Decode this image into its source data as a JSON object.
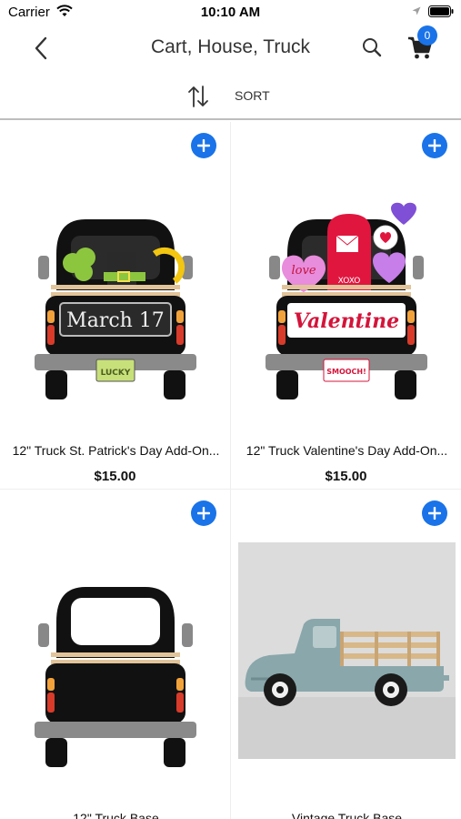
{
  "status_bar": {
    "carrier": "Carrier",
    "time": "10:10 AM"
  },
  "nav": {
    "title": "Cart, House, Truck",
    "cart_count": "0",
    "back_icon": "chevron-left-icon",
    "search_icon": "search-icon",
    "cart_icon": "cart-icon"
  },
  "sort": {
    "label": "SORT",
    "icon": "sort-arrows-icon"
  },
  "products": [
    {
      "name": "12\" Truck St. Patrick's Day Add-On...",
      "price": "$15.00",
      "image": {
        "kind": "truck",
        "sign_text": "March 17",
        "plate_text": "LUCKY"
      }
    },
    {
      "name": "12\" Truck Valentine's Day Add-On...",
      "price": "$15.00",
      "image": {
        "kind": "truck",
        "sign_text": "Valentine",
        "plate_text": "SMOOCH!",
        "mailbox_text": "XOXO",
        "heart_text": "love"
      }
    },
    {
      "name": "12\" Truck Base",
      "price": "",
      "image": {
        "kind": "truck"
      }
    },
    {
      "name": "Vintage Truck Base",
      "price": "",
      "image": {
        "kind": "photo"
      }
    }
  ],
  "colors": {
    "accent": "#1a73e8",
    "truck_body": "#111111",
    "bumper": "#8a8a8a"
  }
}
